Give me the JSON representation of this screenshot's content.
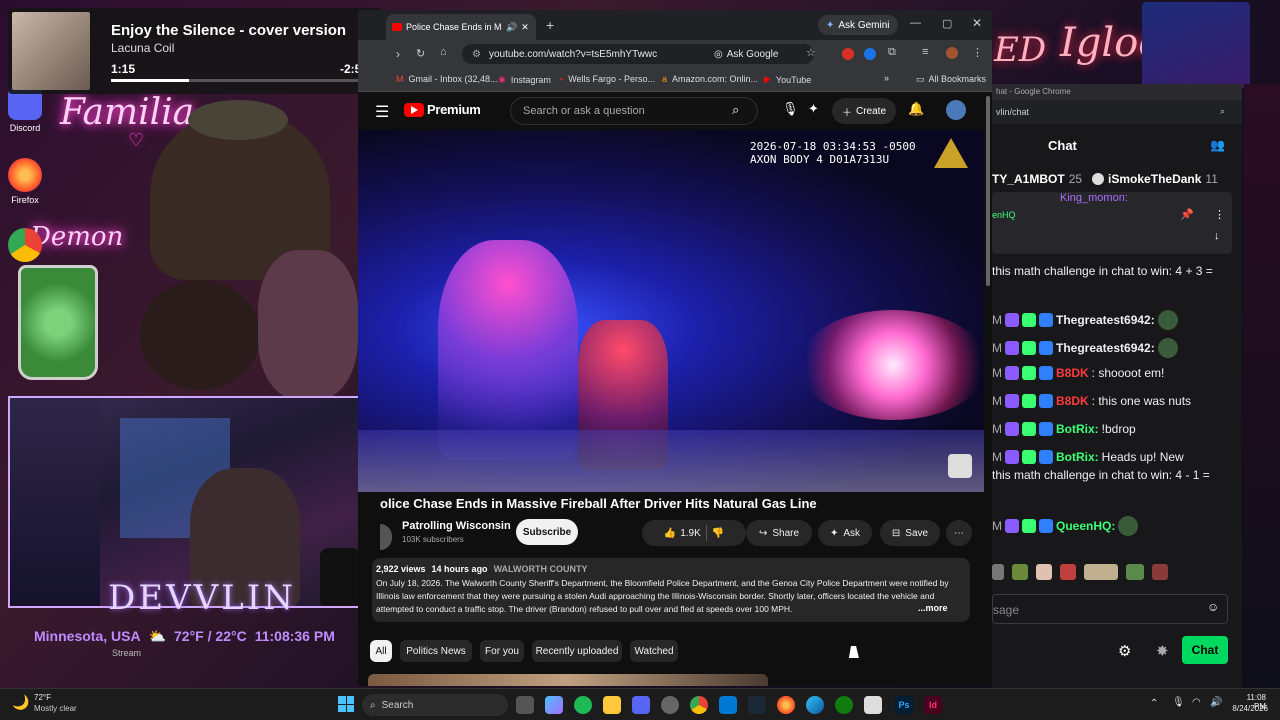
{
  "music": {
    "title": "Enjoy the Silence - cover version",
    "artist": "Lacuna Coil",
    "elapsed": "1:15",
    "remaining": "-2:50",
    "progress": 0.3
  },
  "desktop": {
    "icons": [
      "Discord",
      "Firefox"
    ],
    "neon_texts": [
      "Familia",
      "Demon"
    ],
    "stream_label": "Stream"
  },
  "overlay": {
    "name": "DEVVLIN",
    "location": "Minnesota, USA",
    "weather": "72°F / 22°C",
    "time": "11:08:36 PM"
  },
  "browser": {
    "tab_title": "Police Chase Ends in Massive",
    "gemini": "Ask Gemini",
    "url": "youtube.com/watch?v=tsE5mhYTwwc",
    "ask_google": "Ask Google",
    "bookmarks": [
      "Gmail - Inbox (32,48...",
      "Instagram",
      "Wells Fargo - Perso...",
      "Amazon.com: Onlin...",
      "YouTube"
    ],
    "all_bookmarks": "All Bookmarks"
  },
  "youtube": {
    "logo": "Premium",
    "search_placeholder": "Search or ask a question",
    "create": "Create",
    "video_timestamp": "2026-07-18 03:34:53 -0500",
    "video_device": "AXON BODY 4 D01A7313U",
    "title": "olice Chase Ends in Massive Fireball After Driver Hits Natural Gas Line",
    "channel": "Patrolling Wisconsin",
    "subscribers": "103K subscribers",
    "subscribe": "Subscribe",
    "likes": "1.9K",
    "share": "Share",
    "ask": "Ask",
    "save": "Save",
    "views": "2,922 views",
    "age": "14 hours ago",
    "location_tag": "WALWORTH COUNTY",
    "description": "On July 18, 2026. The Walworth County Sheriff's Department, the Bloomfield Police Department, and the Genoa City Police Department were notified by Illinois law enforcement that they were pursuing a stolen Audi approaching the Illinois-Wisconsin border. Shortly later, officers located the vehicle and attempted to conduct a traffic stop. The driver (Brandon) refused to pull over and fled at speeds over 100 MPH.",
    "more": "...more",
    "chips": [
      "All",
      "Politics News",
      "For you",
      "Recently uploaded",
      "Watched"
    ]
  },
  "chat": {
    "window_title": "hat - Google Chrome",
    "url": "vlin/chat",
    "header": "Chat",
    "pinned_left": "TY_A1MBOT",
    "pinned_left_count": "25",
    "pinned_right": "iSmokeTheDank",
    "pinned_right_count": "11",
    "pinned_user": "King_momon:",
    "pinned_sub": "enHQ",
    "messages": [
      {
        "prefix": "",
        "user": "",
        "text": "this math challenge in chat to win: 4 + 3 =",
        "user_color": "#efeff1"
      },
      {
        "prefix": "M",
        "user": "Thegreatest6942:",
        "text": "",
        "user_color": "#efeff1"
      },
      {
        "prefix": "M",
        "user": "Thegreatest6942:",
        "text": "",
        "user_color": "#efeff1"
      },
      {
        "prefix": "M",
        "user": "B8DK",
        "text": ": shoooot em!",
        "user_color": "#ff3b3b"
      },
      {
        "prefix": "M",
        "user": "B8DK",
        "text": ": this one was nuts",
        "user_color": "#ff3b3b"
      },
      {
        "prefix": "M",
        "user": "BotRix:",
        "text": "!bdrop",
        "user_color": "#3bff73"
      },
      {
        "prefix": "M",
        "user": "BotRix:",
        "text": "Heads up! New",
        "user_color": "#3bff73"
      },
      {
        "prefix": "",
        "user": "",
        "text": "this math challenge in chat to win: 4 - 1 =",
        "user_color": "#efeff1"
      },
      {
        "prefix": "M",
        "user": "QueenHQ:",
        "text": "",
        "user_color": "#3bff73"
      }
    ],
    "input_placeholder": "sage",
    "chat_button": "Chat"
  },
  "taskbar": {
    "weather_temp": "72°F",
    "weather_desc": "Mostly clear",
    "search": "Search",
    "time": "11:08 PM",
    "date": "8/24/2026"
  },
  "colors": {
    "yt_red": "#ff0000",
    "twitch_green": "#00d95f",
    "neon_pink": "#ff3fd0",
    "overlay_purple": "#c08bff"
  }
}
